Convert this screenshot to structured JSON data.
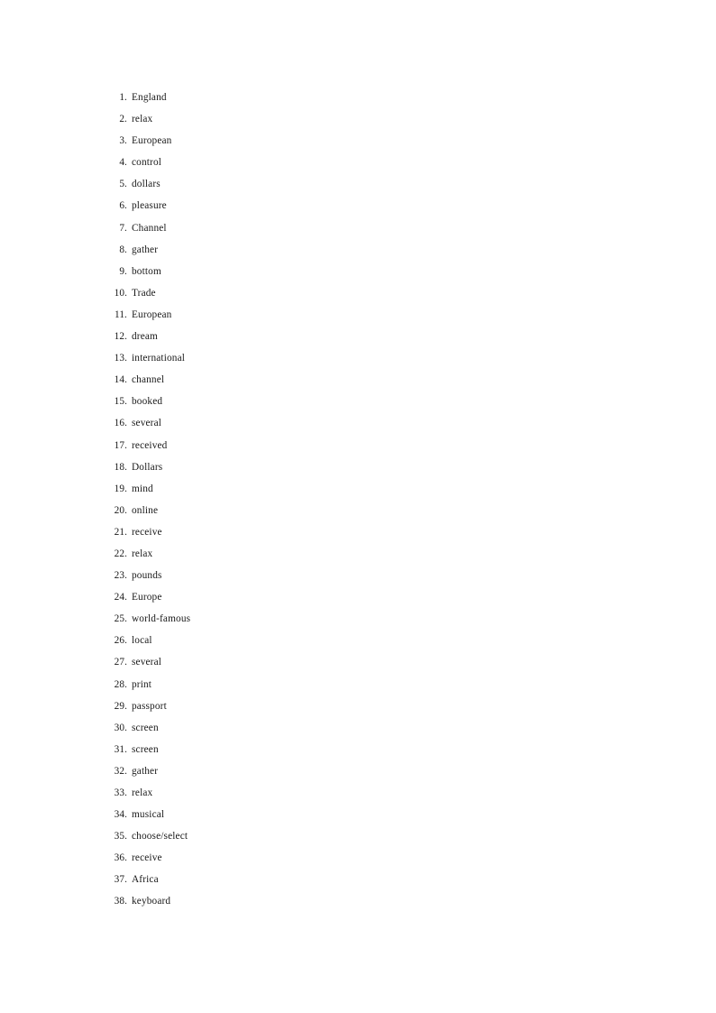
{
  "document": {
    "page_background": "#ffffff",
    "text_color": "#1a1a1a",
    "page_number_visible": "",
    "list": {
      "marker_style": "decimal-period",
      "items": [
        {
          "marker": "1.",
          "text": "England"
        },
        {
          "marker": "2.",
          "text": "relax"
        },
        {
          "marker": "3.",
          "text": "European"
        },
        {
          "marker": "4.",
          "text": "control"
        },
        {
          "marker": "5.",
          "text": "dollars"
        },
        {
          "marker": "6.",
          "text": "pleasure"
        },
        {
          "marker": "7.",
          "text": "Channel"
        },
        {
          "marker": "8.",
          "text": "gather"
        },
        {
          "marker": "9.",
          "text": "bottom"
        },
        {
          "marker": "10.",
          "text": "Trade"
        },
        {
          "marker": "11.",
          "text": "European"
        },
        {
          "marker": "12.",
          "text": "dream"
        },
        {
          "marker": "13.",
          "text": "international"
        },
        {
          "marker": "14.",
          "text": "channel"
        },
        {
          "marker": "15.",
          "text": "booked"
        },
        {
          "marker": "16.",
          "text": "several"
        },
        {
          "marker": "17.",
          "text": "received"
        },
        {
          "marker": "18.",
          "text": "Dollars"
        },
        {
          "marker": "19.",
          "text": "mind"
        },
        {
          "marker": "20.",
          "text": "online"
        },
        {
          "marker": "21.",
          "text": "receive"
        },
        {
          "marker": "22.",
          "text": "relax"
        },
        {
          "marker": "23.",
          "text": "pounds"
        },
        {
          "marker": "24.",
          "text": "Europe"
        },
        {
          "marker": "25.",
          "text": "world-famous"
        },
        {
          "marker": "26.",
          "text": "local"
        },
        {
          "marker": "27.",
          "text": "several"
        },
        {
          "marker": "28.",
          "text": "print"
        },
        {
          "marker": "29.",
          "text": "passport"
        },
        {
          "marker": "30.",
          "text": "screen"
        },
        {
          "marker": "31.",
          "text": "screen"
        },
        {
          "marker": "32.",
          "text": "gather"
        },
        {
          "marker": "33.",
          "text": "relax"
        },
        {
          "marker": "34.",
          "text": "musical"
        },
        {
          "marker": "35.",
          "text": "choose/select"
        },
        {
          "marker": "36.",
          "text": "receive"
        },
        {
          "marker": "37.",
          "text": "Africa"
        },
        {
          "marker": "38.",
          "text": "keyboard"
        }
      ]
    }
  }
}
